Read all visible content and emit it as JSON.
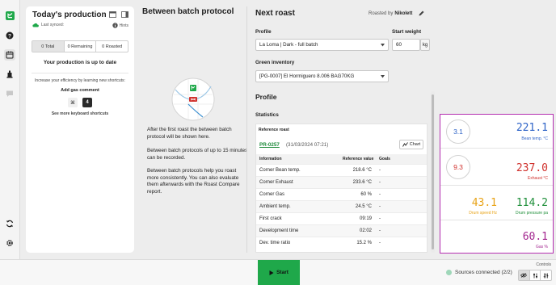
{
  "colors": {
    "brand_green": "#1fa84a",
    "bean_temp": "#2f64c7",
    "exhaust": "#d0312d",
    "drum_speed": "#e8a317",
    "drum_pressure": "#1f8f3a",
    "gas": "#a3268f",
    "highlight_border": "#b42fb0"
  },
  "sidebar": {
    "icons": [
      "logo-icon",
      "help-icon",
      "production-icon",
      "roaster-icon",
      "chat-icon",
      "sync-icon",
      "settings-icon"
    ]
  },
  "production": {
    "title": "Today's production",
    "last_synced": "Last synced:",
    "hints": "Hints",
    "tabs": [
      "0 Total",
      "0 Remaining",
      "0 Roasted"
    ],
    "status": "Your production is up to date",
    "tip": "Increase your efficiency by learning new shortcuts:",
    "shortcut_title": "Add gas comment",
    "shortcut_keys": [
      "⌘",
      "4"
    ],
    "more_link": "See more keyboard shortcuts"
  },
  "between_batch": {
    "title": "Between batch protocol",
    "text1": "After the first roast the between batch protocol will be shown here.",
    "text2": "Between batch protocols of up to 15 minutes can be recorded.",
    "text3": "Between batch protocols help you roast more consistently. You can also evaluate them afterwards with the Roast Compare report."
  },
  "next_roast": {
    "title": "Next roast",
    "roasted_by_label": "Roasted by",
    "roasted_by": "Nikolett",
    "profile_label": "Profile",
    "profile_value": "La Loma | Dark - full batch",
    "weight_label": "Start weight",
    "weight_value": "60",
    "weight_unit": "kg",
    "inventory_label": "Green inventory",
    "inventory_value": "[PG-0007] El Hormiguero 8.006 BAG70KG",
    "profile_section": "Profile",
    "statistics": "Statistics",
    "reference_roast_label": "Reference roast",
    "reference_id": "PR-0257",
    "reference_date": "(31/03/2024 07:21)",
    "chart_button": "Chart",
    "table_headers": [
      "Information",
      "Reference value",
      "Goals"
    ],
    "rows": [
      {
        "info": "Corner Bean temp.",
        "value": "218.6 °C",
        "goal": "-"
      },
      {
        "info": "Corner Exhaust",
        "value": "233.6 °C",
        "goal": "-"
      },
      {
        "info": "Corner Gas",
        "value": "60 %",
        "goal": "-"
      },
      {
        "info": "Ambient temp.",
        "value": "24.5 °C",
        "goal": "-"
      },
      {
        "info": "First crack",
        "value": "09:19",
        "goal": "-"
      },
      {
        "info": "Development time",
        "value": "02:02",
        "goal": "-"
      },
      {
        "info": "Dev. time ratio",
        "value": "15.2 %",
        "goal": "-"
      }
    ]
  },
  "sensors": {
    "bean_ror": "3.1",
    "bean_temp": "221.1",
    "bean_temp_label": "Bean temp. °C",
    "exhaust_ror": "9.3",
    "exhaust": "237.0",
    "exhaust_label": "Exhaust °C",
    "drum_speed": "43.1",
    "drum_speed_label": "Drum speed Hz",
    "drum_pressure": "114.2",
    "drum_pressure_label": "Drum pressure pa",
    "gas": "60.1",
    "gas_label": "Gas %"
  },
  "bottom": {
    "start": "Start",
    "sources": "Sources connected (2/2)",
    "controls": "Controls"
  }
}
